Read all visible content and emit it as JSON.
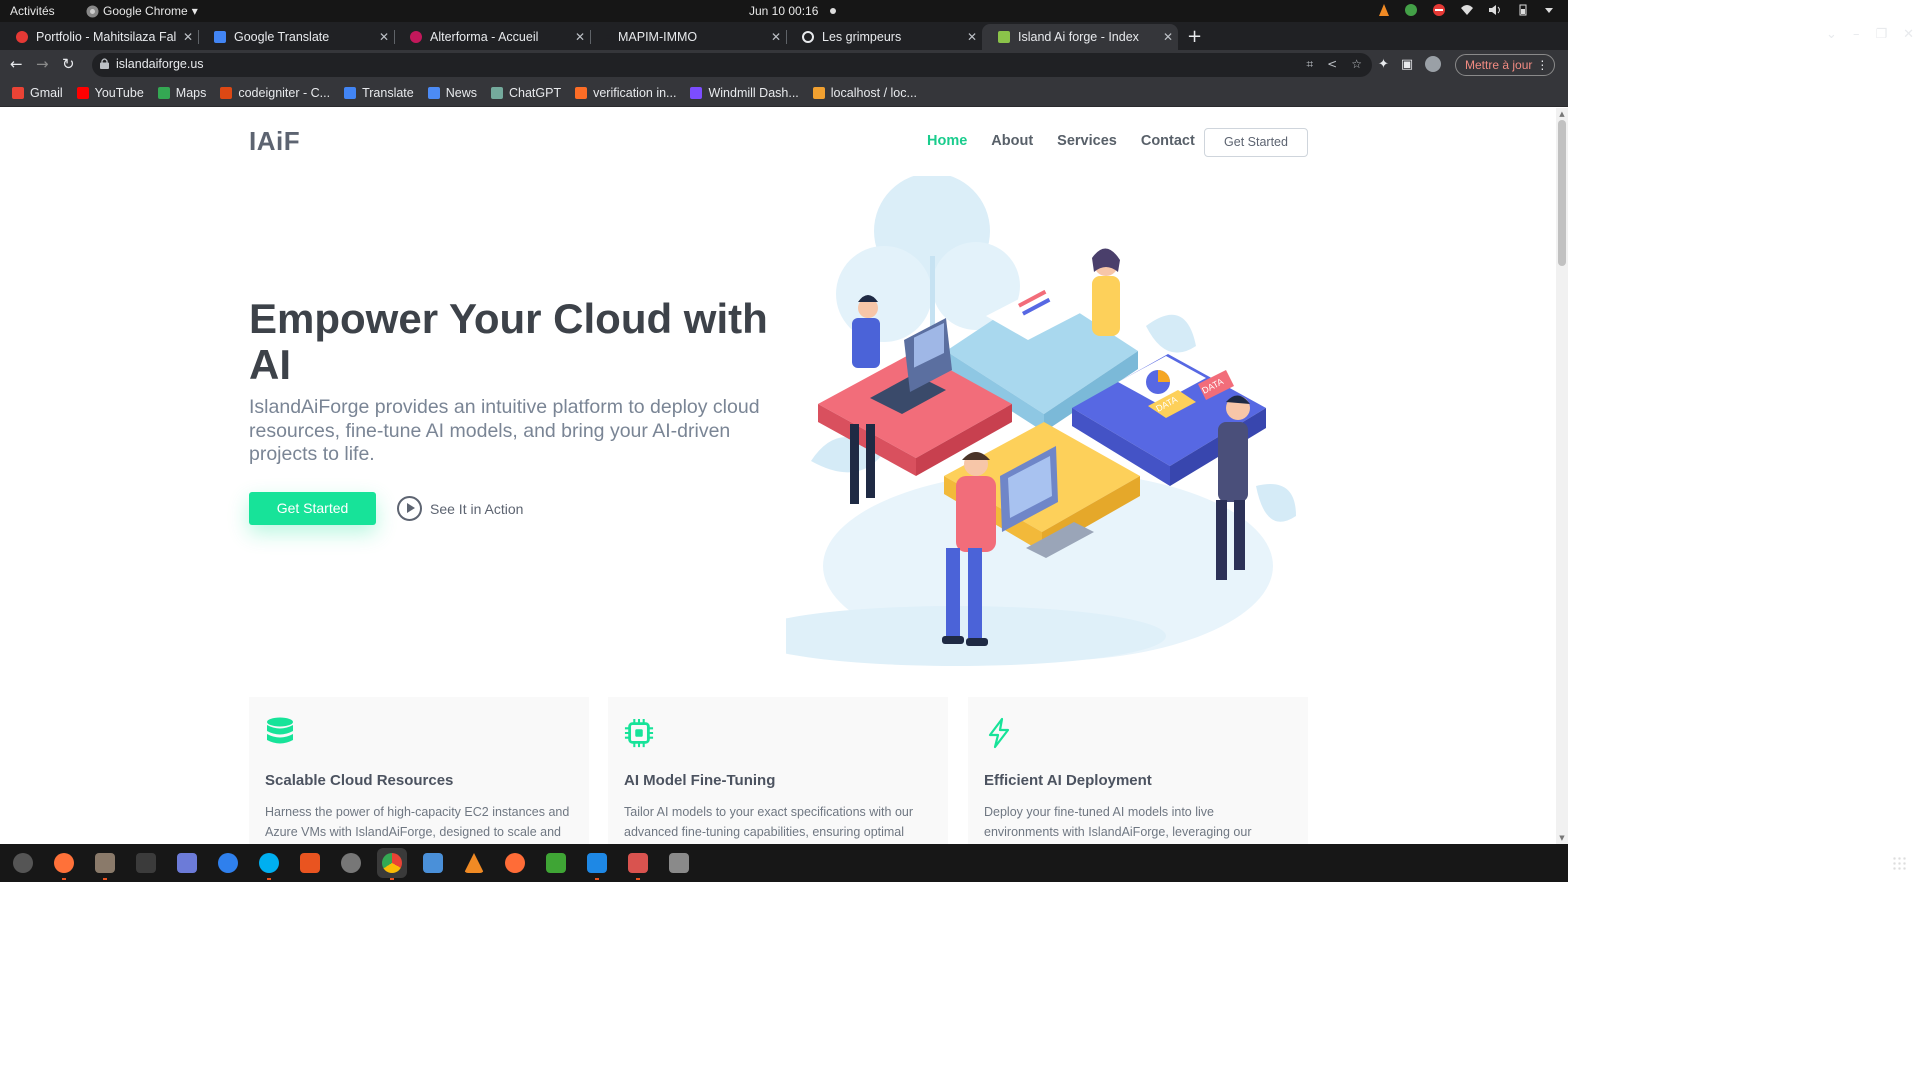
{
  "system": {
    "activities": "Activités",
    "app_name": "Google Chrome",
    "clock": "Jun 10  00:16"
  },
  "tabs": [
    {
      "title": "Portfolio - Mahitsilaza Fal",
      "color": "#e53935"
    },
    {
      "title": "Google Translate",
      "color": "#4285f4"
    },
    {
      "title": "Alterforma - Accueil",
      "color": "#c2185b"
    },
    {
      "title": "MAPIM-IMMO",
      "color": "#9e9e9e"
    },
    {
      "title": "Les grimpeurs",
      "color": "#e8eaed"
    },
    {
      "title": "Island Ai forge - Index",
      "color": "#8bc34a"
    }
  ],
  "browser": {
    "url": "islandaiforge.us",
    "update_label": "Mettre à jour"
  },
  "bookmarks": [
    {
      "label": "Gmail",
      "color": "#ea4335"
    },
    {
      "label": "YouTube",
      "color": "#ff0000"
    },
    {
      "label": "Maps",
      "color": "#34a853"
    },
    {
      "label": "codeigniter - C...",
      "color": "#dd4814"
    },
    {
      "label": "Translate",
      "color": "#4285f4"
    },
    {
      "label": "News",
      "color": "#4c8bf5"
    },
    {
      "label": "ChatGPT",
      "color": "#74aa9c"
    },
    {
      "label": "verification in...",
      "color": "#fc6d26"
    },
    {
      "label": "Windmill Dash...",
      "color": "#7c4dff"
    },
    {
      "label": "localhost / loc...",
      "color": "#f0a030"
    }
  ],
  "site": {
    "logo": "IAiF",
    "nav": [
      "Home",
      "About",
      "Services",
      "Contact"
    ],
    "nav_cta": "Get Started",
    "hero_title": "Empower Your Cloud with AI",
    "hero_subtitle": "IslandAiForge provides an intuitive platform to deploy cloud resources, fine-tune AI models, and bring your AI-driven projects to life.",
    "hero_cta": "Get Started",
    "watch_label": "See It in Action",
    "accent": "#17e399",
    "illustration": {
      "data_label_1": "DATA",
      "data_label_2": "DATA"
    },
    "features": [
      {
        "icon": "database-icon",
        "title": "Scalable Cloud Resources",
        "text": "Harness the power of high-capacity EC2 instances and Azure VMs with IslandAiForge, designed to scale and"
      },
      {
        "icon": "chip-icon",
        "title": "AI Model Fine-Tuning",
        "text": "Tailor AI models to your exact specifications with our advanced fine-tuning capabilities, ensuring optimal"
      },
      {
        "icon": "lightning-icon",
        "title": "Efficient AI Deployment",
        "text": "Deploy your fine-tuned AI models into live environments with IslandAiForge, leveraging our efficient, scalable"
      }
    ]
  }
}
